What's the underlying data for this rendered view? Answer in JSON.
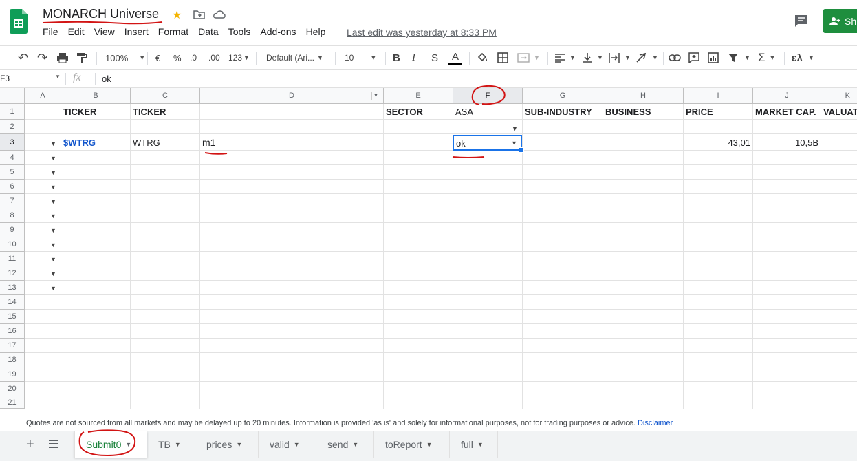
{
  "app": {
    "doc_title": "MONARCH Universe",
    "menu": [
      "File",
      "Edit",
      "View",
      "Insert",
      "Format",
      "Data",
      "Tools",
      "Add-ons",
      "Help"
    ],
    "last_edit": "Last edit was yesterday at 8:33 PM",
    "share_label": "Sh"
  },
  "toolbar": {
    "zoom": "100%",
    "currency": "€",
    "percent": "%",
    "dec_decrease": ".0",
    "dec_increase": ".00",
    "more_formats": "123",
    "font": "Default (Ari...",
    "font_size": "10",
    "bold": "B",
    "italic": "I",
    "strike": "S",
    "text_color": "A",
    "functions": "Σ",
    "input_tools": "ɛλ"
  },
  "formula_bar": {
    "name_box": "F3",
    "fx": "fx",
    "value": "ok"
  },
  "columns": [
    "A",
    "B",
    "C",
    "D",
    "E",
    "F",
    "G",
    "H",
    "I",
    "J",
    "K"
  ],
  "rows": [
    "1",
    "2",
    "3",
    "4",
    "5",
    "6",
    "7",
    "8",
    "9",
    "10",
    "11",
    "12",
    "13",
    "14",
    "15",
    "16",
    "17",
    "18",
    "19",
    "20",
    "21"
  ],
  "cells": {
    "b1": "TICKER",
    "c1": "TICKER",
    "e1": "SECTOR",
    "f1": "ASA",
    "g1": "SUB-INDUSTRY",
    "h1": "BUSINESS",
    "i1": "PRICE",
    "j1": "MARKET CAP.",
    "k1": "VALUAT",
    "b3": "$WTRG",
    "c3": "WTRG",
    "d3": "m1",
    "f3": "ok",
    "i3": "43,01",
    "j3": "10,5B"
  },
  "footer": {
    "note": "Quotes are not sourced from all markets and may be delayed up to 20 minutes. Information is provided 'as is' and solely for informational purposes, not for trading purposes or advice.",
    "disclaimer": "Disclaimer"
  },
  "tabs": [
    "Submit0",
    "TB",
    "prices",
    "valid",
    "send",
    "toReport",
    "full"
  ],
  "colors": {
    "accent": "#1a73e8",
    "share": "#1e8e3e",
    "link": "#1155cc",
    "annotation": "#d21414"
  }
}
